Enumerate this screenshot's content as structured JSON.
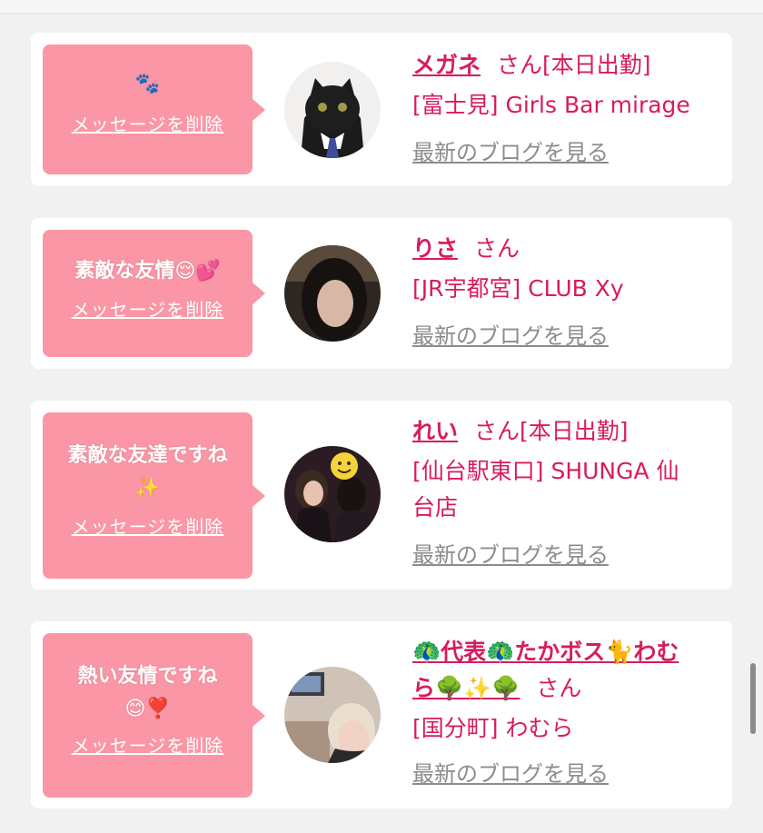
{
  "cards": [
    {
      "message": "🐾",
      "message_line2": "",
      "delete_label": "メッセージを削除",
      "name": "メガネ",
      "honorific": "さん",
      "status": "[本日出勤]",
      "shop": "[富士見] Girls Bar mirage",
      "shop_line2": "",
      "blog_link": "最新のブログを見る"
    },
    {
      "message": "素敵な友情😌💕",
      "message_line2": "",
      "delete_label": "メッセージを削除",
      "name": "りさ",
      "honorific": "さん",
      "status": "",
      "shop": "[JR宇都宮] CLUB Xy",
      "shop_line2": "",
      "blog_link": "最新のブログを見る"
    },
    {
      "message": "素敵な友達ですね",
      "message_line2": "✨",
      "delete_label": "メッセージを削除",
      "name": "れい",
      "honorific": "さん",
      "status": "[本日出勤]",
      "shop": "[仙台駅東口] SHUNGA 仙",
      "shop_line2": "台店",
      "blog_link": "最新のブログを見る"
    },
    {
      "message": "熱い友情ですね",
      "message_line2": "😊❣️",
      "delete_label": "メッセージを削除",
      "name": "🦚代表🦚たかボス🐈わむ",
      "name_line2": "ら🌳✨🌳",
      "honorific": "さん",
      "status": "",
      "shop": "[国分町] わむら",
      "shop_line2": "",
      "blog_link": "最新のブログを見る"
    }
  ],
  "colors": {
    "bubble": "#fa96a5",
    "accent": "#d81b60",
    "link_gray": "#8c8c8c",
    "background": "#f1f1f1"
  }
}
